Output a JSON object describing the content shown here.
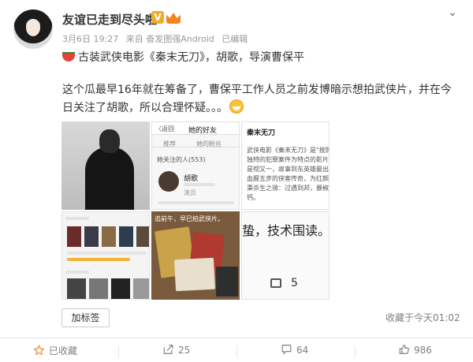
{
  "post": {
    "author": "友谊已走到尽头啦",
    "verified_badge": "V",
    "meta": {
      "date": "3月6日 19:27",
      "source": "来自 奋发图强Android",
      "edited": "已编辑"
    },
    "line1": "古装武侠电影《秦末无刀》，胡歌，导演曹保平",
    "line2": "这个瓜最早16年就在筹备了，曹保平工作人员之前发博暗示想拍武侠片，并在今",
    "line3": "日关注了胡歌，所以合理怀疑。。。"
  },
  "thumb2": {
    "back": "〈返回",
    "title": "她的好友",
    "tabs": [
      "推荐",
      "她的粉丝"
    ],
    "follow_count": "她关注的人(553)",
    "name": "胡歌",
    "sub": "演员"
  },
  "thumb3": {
    "title": "秦末无刀",
    "lines": [
      "武侠电影《秦末无刀》是\"按照曹",
      "独特的犯罪案件为特点的影片\"",
      "是彻又一，故事到东英雄最出的传",
      "血腥五步的侠客传奇，为红颜一怒",
      "秉杀生之骑：过遇到邦，暴椒",
      "钙。"
    ]
  },
  "thumb5": {
    "caption": "追前午，早已拍武侠片。"
  },
  "thumb6": {
    "text": "蛰，技术围读。",
    "count": "5"
  },
  "tag_button": "加标签",
  "favorited_time": "收藏于今天01:02",
  "actions": {
    "favorite": "已收藏",
    "repost": "25",
    "comment": "64",
    "like": "986"
  },
  "colors": {
    "accent": "#f7811d",
    "verified": "#f0ac2c",
    "muted": "#808080"
  }
}
